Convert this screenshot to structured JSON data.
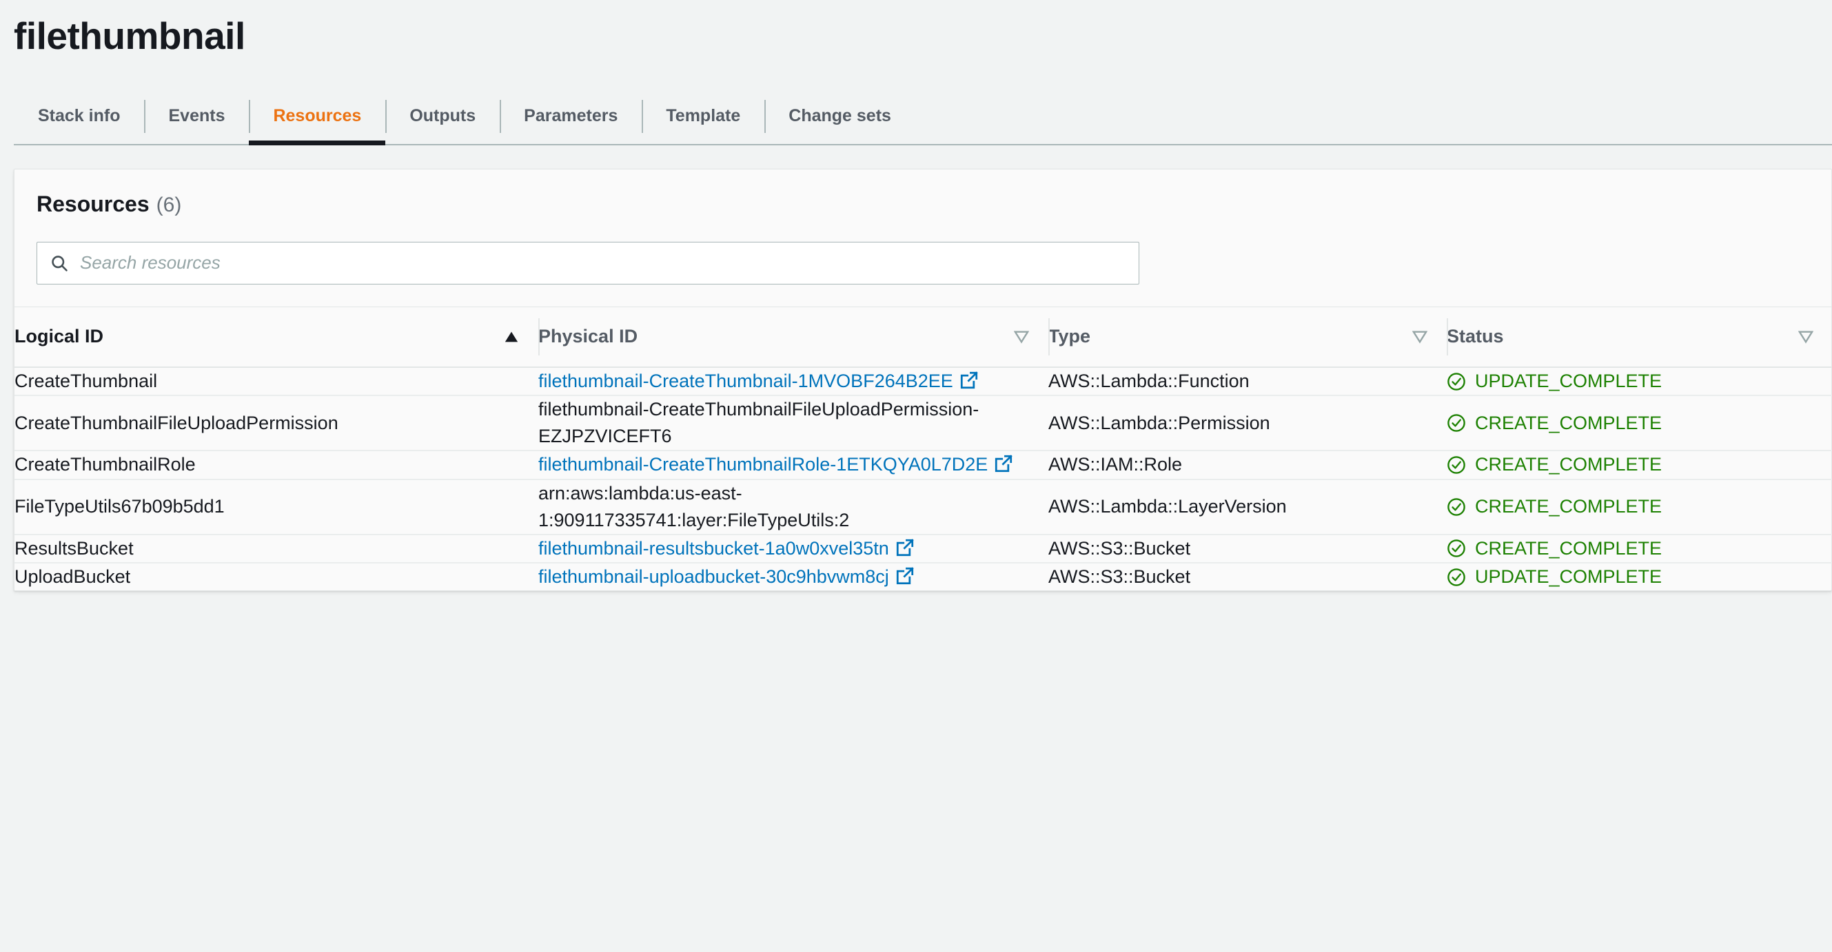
{
  "header": {
    "stack_name": "filethumbnail"
  },
  "tabs": [
    {
      "label": "Stack info",
      "active": false
    },
    {
      "label": "Events",
      "active": false
    },
    {
      "label": "Resources",
      "active": true
    },
    {
      "label": "Outputs",
      "active": false
    },
    {
      "label": "Parameters",
      "active": false
    },
    {
      "label": "Template",
      "active": false
    },
    {
      "label": "Change sets",
      "active": false
    }
  ],
  "panel": {
    "title": "Resources",
    "count": "(6)",
    "search": {
      "placeholder": "Search resources",
      "value": "",
      "icon": "search-icon"
    }
  },
  "table": {
    "columns": [
      {
        "label": "Logical ID",
        "sort": "ascending",
        "sort_icon": "caret-up-filled-icon"
      },
      {
        "label": "Physical ID",
        "sort": "none",
        "sort_icon": "caret-down-outline-icon"
      },
      {
        "label": "Type",
        "sort": "none",
        "sort_icon": "caret-down-outline-icon"
      },
      {
        "label": "Status",
        "sort": "none",
        "sort_icon": "caret-down-outline-icon"
      }
    ],
    "rows": [
      {
        "logical_id": "CreateThumbnail",
        "physical_id": "filethumbnail-CreateThumbnail-1MVOBF264B2EE",
        "physical_is_link": true,
        "type": "AWS::Lambda::Function",
        "status": "UPDATE_COMPLETE",
        "status_icon": "check-circle-icon"
      },
      {
        "logical_id": "CreateThumbnailFileUploadPermission",
        "physical_id": "filethumbnail-CreateThumbnailFileUploadPermission-EZJPZVICEFT6",
        "physical_is_link": false,
        "type": "AWS::Lambda::Permission",
        "status": "CREATE_COMPLETE",
        "status_icon": "check-circle-icon"
      },
      {
        "logical_id": "CreateThumbnailRole",
        "physical_id": "filethumbnail-CreateThumbnailRole-1ETKQYA0L7D2E",
        "physical_is_link": true,
        "type": "AWS::IAM::Role",
        "status": "CREATE_COMPLETE",
        "status_icon": "check-circle-icon"
      },
      {
        "logical_id": "FileTypeUtils67b09b5dd1",
        "physical_id": "arn:aws:lambda:us-east-1:909117335741:layer:FileTypeUtils:2",
        "physical_is_link": false,
        "type": "AWS::Lambda::LayerVersion",
        "status": "CREATE_COMPLETE",
        "status_icon": "check-circle-icon"
      },
      {
        "logical_id": "ResultsBucket",
        "physical_id": "filethumbnail-resultsbucket-1a0w0xvel35tn",
        "physical_is_link": true,
        "type": "AWS::S3::Bucket",
        "status": "CREATE_COMPLETE",
        "status_icon": "check-circle-icon"
      },
      {
        "logical_id": "UploadBucket",
        "physical_id": "filethumbnail-uploadbucket-30c9hbvwm8cj",
        "physical_is_link": true,
        "type": "AWS::S3::Bucket",
        "status": "UPDATE_COMPLETE",
        "status_icon": "check-circle-icon"
      }
    ]
  },
  "colors": {
    "accent_orange": "#ec7211",
    "link_blue": "#0073bb",
    "status_green": "#1d8102",
    "text_dark": "#16191f",
    "text_muted": "#545b64",
    "page_bg": "#f1f3f3",
    "card_bg": "#fafafa",
    "border": "#e3e6e6"
  }
}
